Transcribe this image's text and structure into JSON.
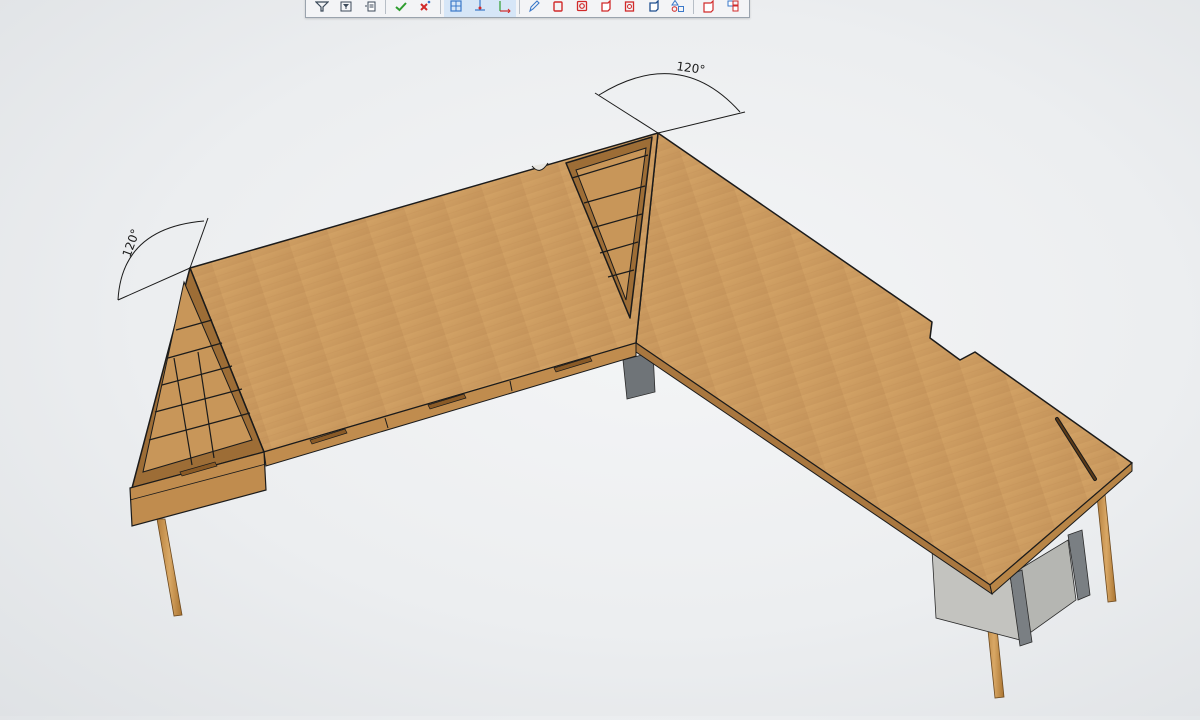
{
  "toolbar": {
    "buttons": [
      {
        "icon": "filter-icon",
        "group": 1
      },
      {
        "icon": "filter-list-icon",
        "group": 1
      },
      {
        "icon": "copy-list-icon",
        "group": 1
      },
      {
        "icon": "accept-check-icon",
        "group": 2,
        "color": "#2e9d2e"
      },
      {
        "icon": "reject-x-icon",
        "group": 2,
        "color": "#d12a2a"
      },
      {
        "icon": "grid-view-icon",
        "group": 3,
        "color": "#3a78c9"
      },
      {
        "icon": "axis-icon",
        "group": 3,
        "color": "#3a78c9"
      },
      {
        "icon": "coordinate-system-icon",
        "group": 3,
        "color": "#2e9d2e"
      },
      {
        "icon": "sketch-pencil-icon",
        "group": 4,
        "color": "#3a78c9"
      },
      {
        "icon": "face-select-icon",
        "group": 4,
        "color": "#d12a2a"
      },
      {
        "icon": "face-loop-icon",
        "group": 4,
        "color": "#d12a2a"
      },
      {
        "icon": "solid-body-icon",
        "group": 4,
        "color": "#d12a2a"
      },
      {
        "icon": "body-ring-icon",
        "group": 4,
        "color": "#d12a2a"
      },
      {
        "icon": "body-outline-icon",
        "group": 4,
        "color": "#1f4f8f"
      },
      {
        "icon": "shapes-icon",
        "group": 4,
        "color": "#3a78c9"
      },
      {
        "icon": "component-icon",
        "group": 5,
        "color": "#d12a2a"
      },
      {
        "icon": "assembly-icon",
        "group": 5,
        "color": "#d12a2a"
      }
    ]
  },
  "dimensions": [
    {
      "label": "120°",
      "id": "angle-left"
    },
    {
      "label": "120°",
      "id": "angle-top"
    }
  ],
  "colors": {
    "wood": "#c89a5e",
    "wood_edge": "#a9773f",
    "outline": "#1b1b1b",
    "metal": "#8d9296",
    "panel": "#c7c7c4"
  }
}
